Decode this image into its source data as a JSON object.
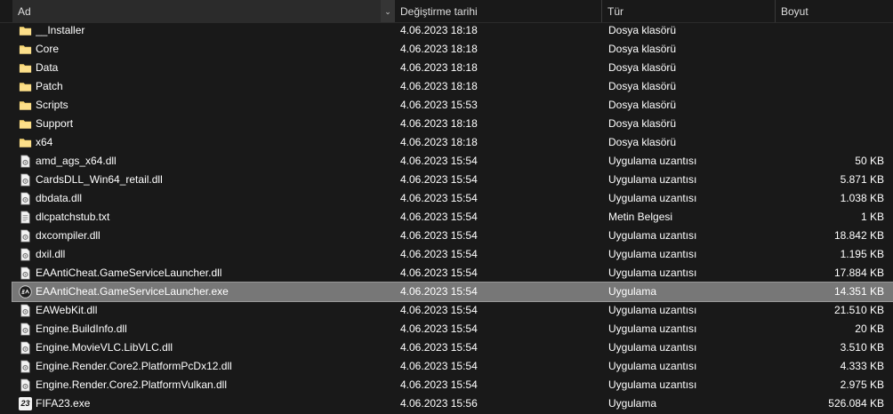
{
  "columns": {
    "name": "Ad",
    "date": "Değiştirme tarihi",
    "type": "Tür",
    "size": "Boyut"
  },
  "files": [
    {
      "name": "__Installer",
      "date": "4.06.2023 18:18",
      "type": "Dosya klasörü",
      "size": "",
      "icon": "folder-icon"
    },
    {
      "name": "Core",
      "date": "4.06.2023 18:18",
      "type": "Dosya klasörü",
      "size": "",
      "icon": "folder-icon"
    },
    {
      "name": "Data",
      "date": "4.06.2023 18:18",
      "type": "Dosya klasörü",
      "size": "",
      "icon": "folder-icon"
    },
    {
      "name": "Patch",
      "date": "4.06.2023 18:18",
      "type": "Dosya klasörü",
      "size": "",
      "icon": "folder-icon"
    },
    {
      "name": "Scripts",
      "date": "4.06.2023 15:53",
      "type": "Dosya klasörü",
      "size": "",
      "icon": "folder-icon"
    },
    {
      "name": "Support",
      "date": "4.06.2023 18:18",
      "type": "Dosya klasörü",
      "size": "",
      "icon": "folder-icon"
    },
    {
      "name": "x64",
      "date": "4.06.2023 18:18",
      "type": "Dosya klasörü",
      "size": "",
      "icon": "folder-icon"
    },
    {
      "name": "amd_ags_x64.dll",
      "date": "4.06.2023 15:54",
      "type": "Uygulama uzantısı",
      "size": "50 KB",
      "icon": "dll-file-icon"
    },
    {
      "name": "CardsDLL_Win64_retail.dll",
      "date": "4.06.2023 15:54",
      "type": "Uygulama uzantısı",
      "size": "5.871 KB",
      "icon": "dll-file-icon"
    },
    {
      "name": "dbdata.dll",
      "date": "4.06.2023 15:54",
      "type": "Uygulama uzantısı",
      "size": "1.038 KB",
      "icon": "dll-file-icon"
    },
    {
      "name": "dlcpatchstub.txt",
      "date": "4.06.2023 15:54",
      "type": "Metin Belgesi",
      "size": "1 KB",
      "icon": "text-file-icon"
    },
    {
      "name": "dxcompiler.dll",
      "date": "4.06.2023 15:54",
      "type": "Uygulama uzantısı",
      "size": "18.842 KB",
      "icon": "dll-file-icon"
    },
    {
      "name": "dxil.dll",
      "date": "4.06.2023 15:54",
      "type": "Uygulama uzantısı",
      "size": "1.195 KB",
      "icon": "dll-file-icon"
    },
    {
      "name": "EAAntiCheat.GameServiceLauncher.dll",
      "date": "4.06.2023 15:54",
      "type": "Uygulama uzantısı",
      "size": "17.884 KB",
      "icon": "dll-file-icon"
    },
    {
      "name": "EAAntiCheat.GameServiceLauncher.exe",
      "date": "4.06.2023 15:54",
      "type": "Uygulama",
      "size": "14.351 KB",
      "icon": "ea-exe-icon",
      "selected": true
    },
    {
      "name": "EAWebKit.dll",
      "date": "4.06.2023 15:54",
      "type": "Uygulama uzantısı",
      "size": "21.510 KB",
      "icon": "dll-file-icon"
    },
    {
      "name": "Engine.BuildInfo.dll",
      "date": "4.06.2023 15:54",
      "type": "Uygulama uzantısı",
      "size": "20 KB",
      "icon": "dll-file-icon"
    },
    {
      "name": "Engine.MovieVLC.LibVLC.dll",
      "date": "4.06.2023 15:54",
      "type": "Uygulama uzantısı",
      "size": "3.510 KB",
      "icon": "dll-file-icon"
    },
    {
      "name": "Engine.Render.Core2.PlatformPcDx12.dll",
      "date": "4.06.2023 15:54",
      "type": "Uygulama uzantısı",
      "size": "4.333 KB",
      "icon": "dll-file-icon"
    },
    {
      "name": "Engine.Render.Core2.PlatformVulkan.dll",
      "date": "4.06.2023 15:54",
      "type": "Uygulama uzantısı",
      "size": "2.975 KB",
      "icon": "dll-file-icon"
    },
    {
      "name": "FIFA23.exe",
      "date": "4.06.2023 15:56",
      "type": "Uygulama",
      "size": "526.084 KB",
      "icon": "fifa23-exe-icon",
      "icon_text": "23"
    }
  ],
  "colors": {
    "background": "#191919",
    "selected_row": "#777777",
    "folder": "#f8d775",
    "header_active": "#2b2b2b"
  }
}
